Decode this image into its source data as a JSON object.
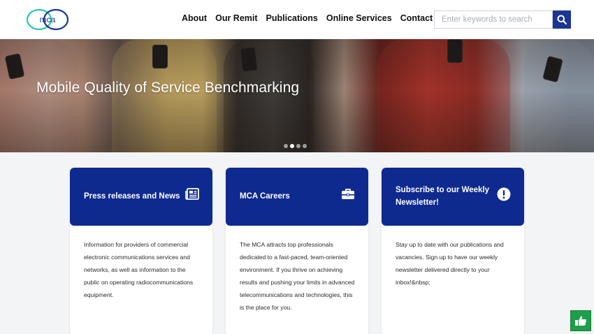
{
  "header": {
    "logo_text": "mca",
    "nav": [
      "About",
      "Our Remit",
      "Publications",
      "Online Services",
      "Contact Us"
    ],
    "search_placeholder": "Enter keywords to search"
  },
  "hero": {
    "title": "Mobile Quality of Service Benchmarking",
    "slides_total": 4,
    "active_slide": 2
  },
  "cards": [
    {
      "title": "Press releases and News",
      "icon": "newspaper-icon",
      "body": "Information for providers of commercial electronic communications services and networks, as well as information to the public on operating radiocommunications equipment."
    },
    {
      "title": "MCA Careers",
      "icon": "briefcase-icon",
      "body": "The MCA attracts top professionals dedicated to a fast-paced, team-oriented environment. If you thrive on achieving results and pushing your limits in advanced telecommunications and technologies, this is the place for you."
    },
    {
      "title": "Subscribe to our Weekly Newsletter!",
      "icon": "exclamation-icon",
      "body": "Stay up to date with our publications and vacancies. Sign up to have our weekly newsletter delivered directly to your inbox!&nbsp;"
    }
  ],
  "floating": {
    "icon": "thumbs-up-icon"
  },
  "colors": {
    "brand_blue": "#0e2a8f",
    "search_button": "#1a3593",
    "like_button": "#1e9e4a",
    "logo_teal": "#2ec4b6"
  }
}
